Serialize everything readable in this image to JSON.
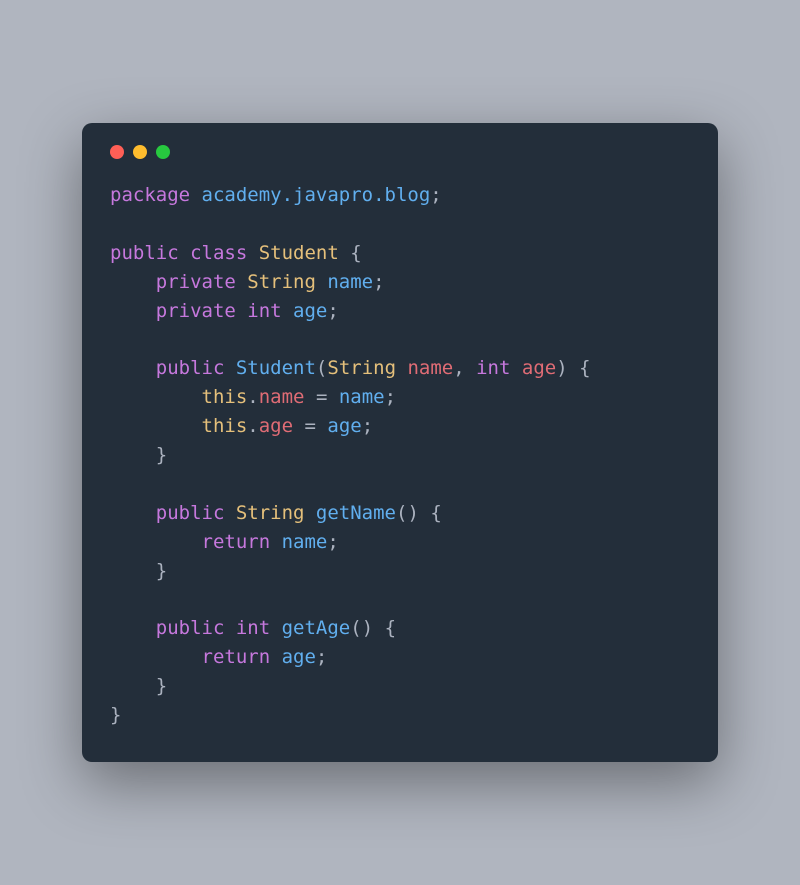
{
  "window": {
    "buttons": {
      "close": "close",
      "minimize": "minimize",
      "maximize": "maximize"
    }
  },
  "code": {
    "line1": {
      "package_kw": "package",
      "package_name": " academy.javapro.blog",
      "semi": ";"
    },
    "line3": {
      "public_kw": "public",
      "class_kw": " class",
      "class_name": " Student",
      "brace": " {"
    },
    "line4": {
      "indent": "    ",
      "private_kw": "private",
      "type": " String",
      "name": " name",
      "semi": ";"
    },
    "line5": {
      "indent": "    ",
      "private_kw": "private",
      "type": " int",
      "name": " age",
      "semi": ";"
    },
    "line7": {
      "indent": "    ",
      "public_kw": "public",
      "ctor": " Student",
      "paren_open": "(",
      "ptype1": "String",
      "pname1": " name",
      "comma": ",",
      "ptype2": " int",
      "pname2": " age",
      "paren_close": ")",
      "brace": " {"
    },
    "line8": {
      "indent": "        ",
      "this_kw": "this",
      "dot": ".",
      "prop": "name",
      "eq": " = ",
      "val": "name",
      "semi": ";"
    },
    "line9": {
      "indent": "        ",
      "this_kw": "this",
      "dot": ".",
      "prop": "age",
      "eq": " = ",
      "val": "age",
      "semi": ";"
    },
    "line10": {
      "indent": "    ",
      "brace": "}"
    },
    "line12": {
      "indent": "    ",
      "public_kw": "public",
      "type": " String",
      "method": " getName",
      "parens": "()",
      "brace": " {"
    },
    "line13": {
      "indent": "        ",
      "return_kw": "return",
      "val": " name",
      "semi": ";"
    },
    "line14": {
      "indent": "    ",
      "brace": "}"
    },
    "line16": {
      "indent": "    ",
      "public_kw": "public",
      "type": " int",
      "method": " getAge",
      "parens": "()",
      "brace": " {"
    },
    "line17": {
      "indent": "        ",
      "return_kw": "return",
      "val": " age",
      "semi": ";"
    },
    "line18": {
      "indent": "    ",
      "brace": "}"
    },
    "line19": {
      "brace": "}"
    }
  }
}
